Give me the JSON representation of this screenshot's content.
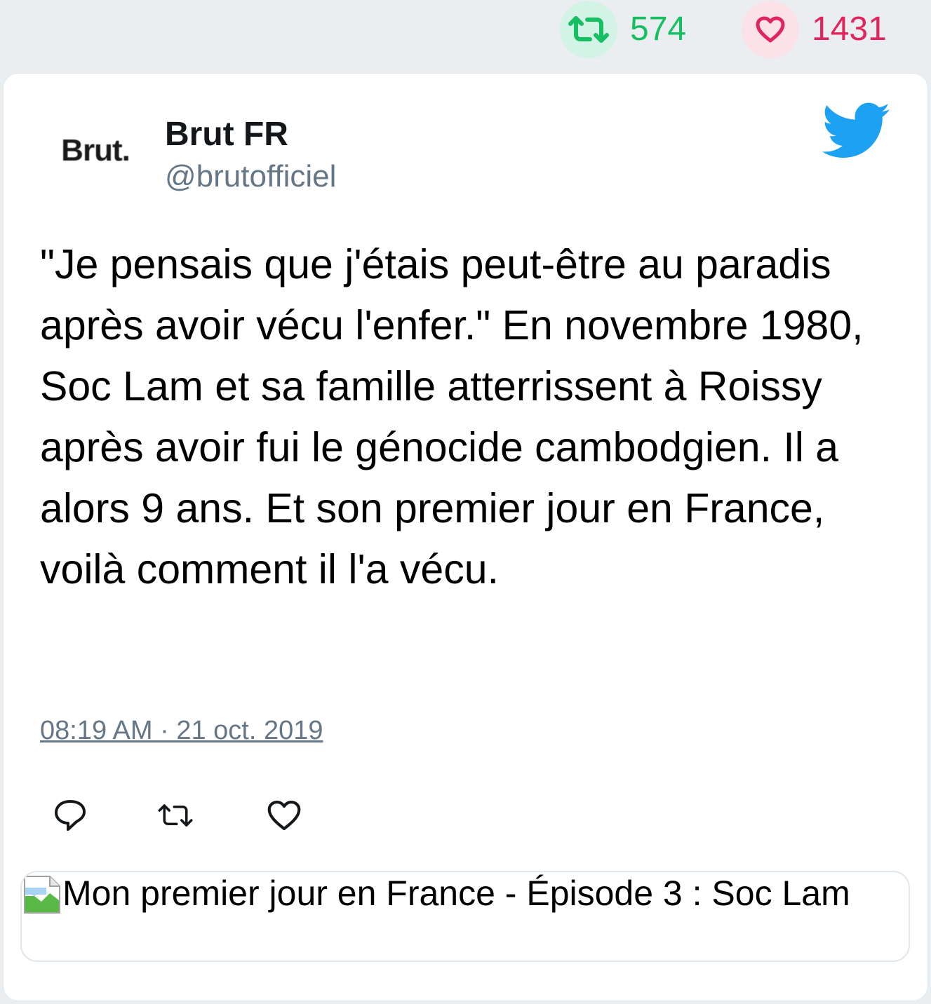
{
  "stats": {
    "retweets": "574",
    "likes": "1431",
    "retweet_icon": "retweet-icon",
    "like_icon": "heart-icon",
    "retweet_color": "#17bf63",
    "like_color": "#e0245e"
  },
  "author": {
    "avatar_text": "Brut.",
    "name": "Brut FR",
    "handle": "@brutofficiel"
  },
  "tweet": {
    "text": "\"Je pensais que j'étais peut-être au paradis après avoir vécu l'enfer.\" En novembre 1980, Soc Lam et sa famille atterrissent à Roissy après avoir fui le génocide cambodgien. Il a alors 9 ans. Et son premier jour en France, voilà comment il l'a vécu.",
    "timestamp": "08:19 AM · 21 oct. 2019"
  },
  "actions": {
    "reply_icon": "reply-icon",
    "retweet_icon": "retweet-icon",
    "like_icon": "heart-icon"
  },
  "link_card": {
    "title": "Mon premier jour en France - Épisode 3 : Soc Lam",
    "image_icon": "broken-image-icon"
  },
  "brand": {
    "logo": "twitter-bird-icon",
    "color": "#1da1f2"
  }
}
